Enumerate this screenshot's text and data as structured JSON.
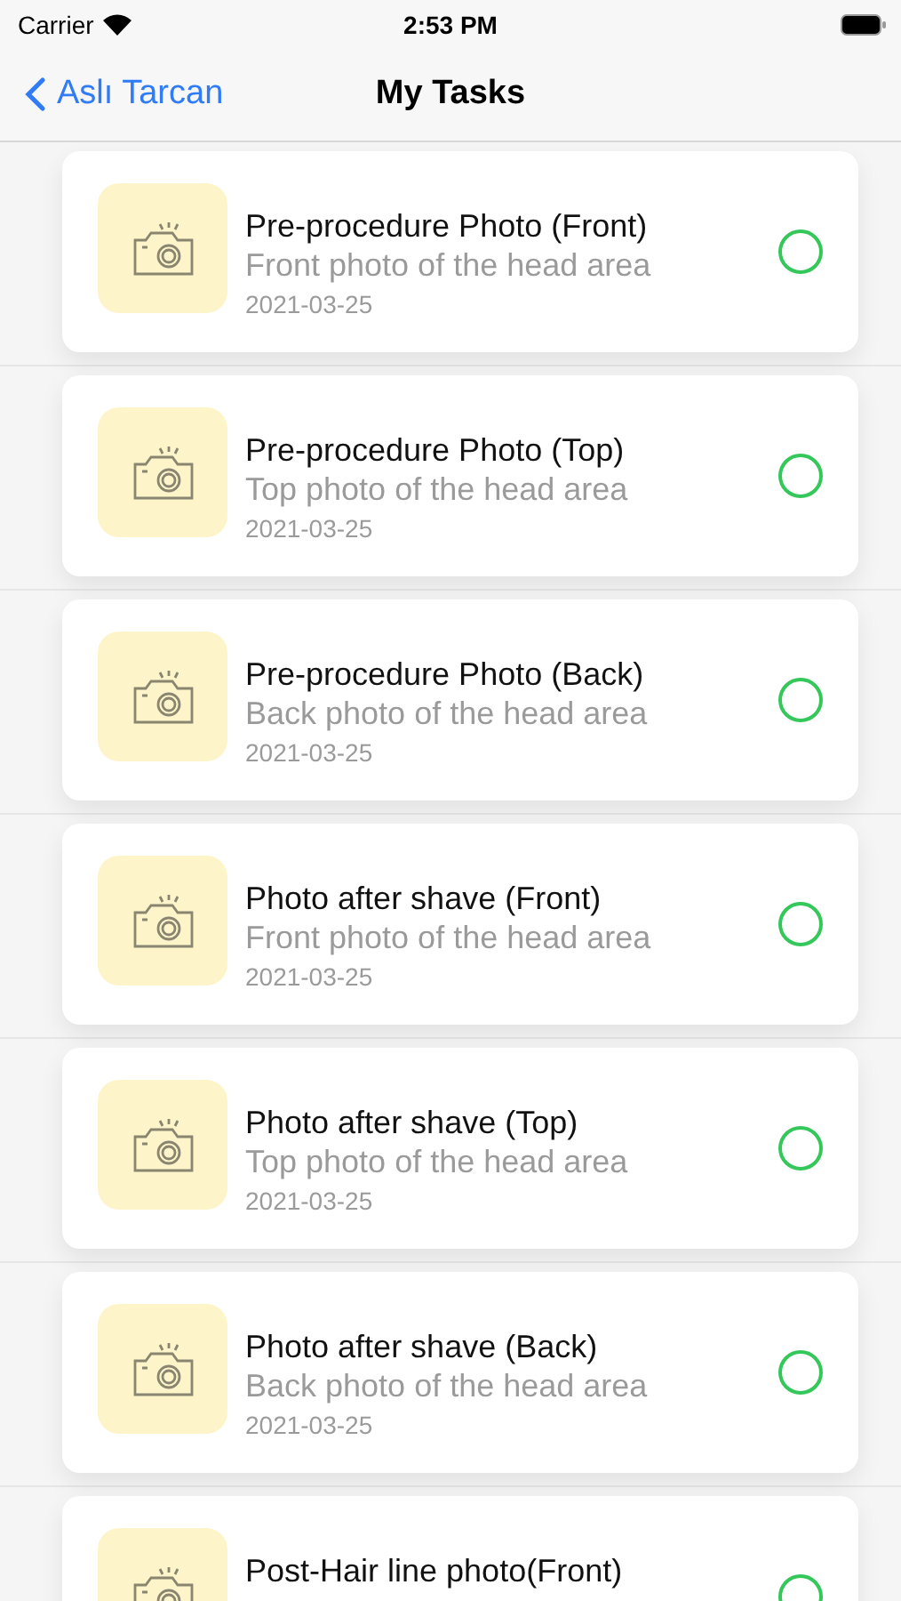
{
  "status_bar": {
    "carrier": "Carrier",
    "time": "2:53 PM"
  },
  "nav": {
    "back_label": "Aslı Tarcan",
    "title": "My Tasks"
  },
  "tasks": [
    {
      "title": "Pre-procedure Photo (Front)",
      "subtitle": "Front photo of the head area",
      "date": "2021-03-25",
      "checked": false
    },
    {
      "title": "Pre-procedure Photo (Top)",
      "subtitle": "Top photo of the head area",
      "date": "2021-03-25",
      "checked": false
    },
    {
      "title": "Pre-procedure Photo (Back)",
      "subtitle": "Back photo of the head area",
      "date": "2021-03-25",
      "checked": false
    },
    {
      "title": "Photo after shave (Front)",
      "subtitle": "Front photo of the head area",
      "date": "2021-03-25",
      "checked": false
    },
    {
      "title": "Photo after shave (Top)",
      "subtitle": "Top photo of the head area",
      "date": "2021-03-25",
      "checked": false
    },
    {
      "title": "Photo after shave (Back)",
      "subtitle": "Back photo of the head area",
      "date": "2021-03-25",
      "checked": false
    },
    {
      "title": "Post-Hair line photo(Front)",
      "checked": false
    }
  ]
}
